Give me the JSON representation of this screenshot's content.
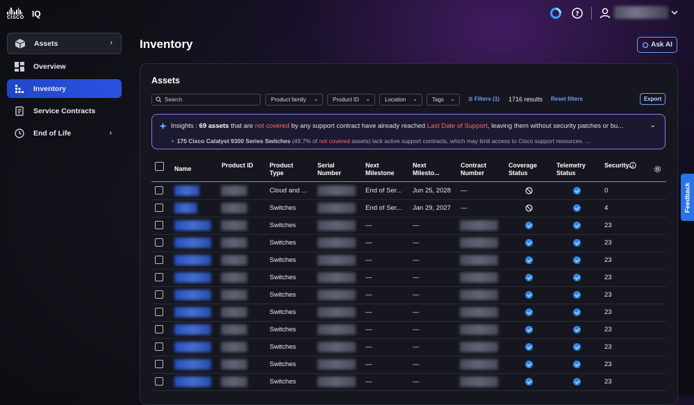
{
  "app": {
    "logo_text": "CISCO",
    "product": "IQ"
  },
  "sidebar": {
    "items": [
      {
        "label": "Assets",
        "icon": "box-icon"
      },
      {
        "label": "Overview",
        "icon": "dashboard-icon"
      },
      {
        "label": "Inventory",
        "icon": "inventory-grid-icon"
      },
      {
        "label": "Service Contracts",
        "icon": "contract-doc-icon"
      },
      {
        "label": "End of Life",
        "icon": "clock-icon"
      }
    ]
  },
  "header": {
    "title": "Inventory",
    "ask_ai": "Ask AI"
  },
  "card": {
    "title": "Assets",
    "search_placeholder": "Search",
    "filters": [
      "Product family",
      "Product ID",
      "Location",
      "Tags"
    ],
    "filters_link": "Filters (1)",
    "results": "1716 results",
    "reset": "Reset filters",
    "export": "Export"
  },
  "insights": {
    "label": "Insights :",
    "count": "69 assets",
    "t1": "that are",
    "not_covered": "not covered",
    "t2": "by any support contract have already reached",
    "ldos": "Last Date of Support",
    "t3": ", leaving them without security patches or bu...",
    "bullet_bold": "175 Cisco Catalyst 9300 Series Switches",
    "bullet_t1": "(49.7% of",
    "bullet_red": "not covered",
    "bullet_t2": "assets) lack active support contracts, which may limit access to Cisco support resources. ..."
  },
  "table": {
    "headers": [
      "Name",
      "Product ID",
      "Product Type",
      "Serial Number",
      "Next Milestone",
      "Next Milesto...",
      "Contract Number",
      "Coverage Status",
      "Telemetry Status",
      "Security..."
    ],
    "rows": [
      {
        "type": "Cloud and ...",
        "milestone": "End of Ser...",
        "date": "Jun 25, 2028",
        "contract": "—",
        "coverage": "not-covered",
        "telemetry": "ok",
        "security": "0"
      },
      {
        "type": "Switches",
        "milestone": "End of Ser...",
        "date": "Jan 29, 2027",
        "contract": "—",
        "coverage": "not-covered",
        "telemetry": "ok",
        "security": "4"
      },
      {
        "type": "Switches",
        "milestone": "—",
        "date": "—",
        "contract": "",
        "coverage": "ok",
        "telemetry": "ok",
        "security": "23"
      },
      {
        "type": "Switches",
        "milestone": "—",
        "date": "—",
        "contract": "",
        "coverage": "ok",
        "telemetry": "ok",
        "security": "23"
      },
      {
        "type": "Switches",
        "milestone": "—",
        "date": "—",
        "contract": "",
        "coverage": "ok",
        "telemetry": "ok",
        "security": "23"
      },
      {
        "type": "Switches",
        "milestone": "—",
        "date": "—",
        "contract": "",
        "coverage": "ok",
        "telemetry": "ok",
        "security": "23"
      },
      {
        "type": "Switches",
        "milestone": "—",
        "date": "—",
        "contract": "",
        "coverage": "ok",
        "telemetry": "ok",
        "security": "23"
      },
      {
        "type": "Switches",
        "milestone": "—",
        "date": "—",
        "contract": "",
        "coverage": "ok",
        "telemetry": "ok",
        "security": "23"
      },
      {
        "type": "Switches",
        "milestone": "—",
        "date": "—",
        "contract": "",
        "coverage": "ok",
        "telemetry": "ok",
        "security": "23"
      },
      {
        "type": "Switches",
        "milestone": "—",
        "date": "—",
        "contract": "",
        "coverage": "ok",
        "telemetry": "ok",
        "security": "23"
      },
      {
        "type": "Switches",
        "milestone": "—",
        "date": "—",
        "contract": "",
        "coverage": "ok",
        "telemetry": "ok",
        "security": "23"
      },
      {
        "type": "Switches",
        "milestone": "—",
        "date": "—",
        "contract": "",
        "coverage": "ok",
        "telemetry": "ok",
        "security": "23"
      }
    ]
  },
  "feedback": "Feedback",
  "colors": {
    "accent": "#2a52e3",
    "link": "#6d9cff",
    "alert": "#ff6a6a",
    "ok": "#2f86e8"
  }
}
